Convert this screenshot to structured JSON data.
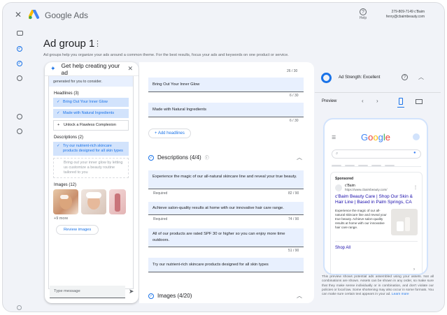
{
  "header": {
    "brand": "Google Ads",
    "help_label": "Help",
    "account_id": "279-809-7149 c'Baim",
    "account_email": "fenry@cbaimbeauty.com"
  },
  "page": {
    "title": "Ad group 1",
    "subtitle": "Ad groups help you organize your ads around a common theme. For the best results, focus your ads and keywords on one product or service."
  },
  "assistant": {
    "title": "Get help creating your ad",
    "intro": "generated for you to consider.",
    "headlines_label": "Headlines (3)",
    "headlines": [
      {
        "text": "Bring Out Your Inner Glow",
        "state": "selected"
      },
      {
        "text": "Made with Natural Ingredients",
        "state": "selected"
      },
      {
        "text": "Unlock a Flawless Complexion",
        "state": "unselected"
      }
    ],
    "descriptions_label": "Descriptions (2)",
    "descriptions": [
      {
        "text": "Try our nutrient-rich skincare products designed for all skin types",
        "state": "selected"
      },
      {
        "text": "Bring out your inner glow by letting us customize a beauty routine tailored to you",
        "state": "faded"
      }
    ],
    "images_label": "Images (12)",
    "images_more": "+9 more",
    "review_label": "Review images",
    "message_placeholder": "Type message"
  },
  "editor": {
    "counts": [
      "26 / 30",
      "6 / 30",
      "6 / 30"
    ],
    "headline_fields": [
      "Bring Out Your Inner Glow",
      "Made with Natural Ingredients"
    ],
    "add_headlines": "Add headlines",
    "descriptions_header": "Descriptions (4/4)",
    "descriptions": [
      {
        "text": "Experience the magic of our all-natural skincare line and reveal your true beauty.",
        "count": "82 / 90"
      },
      {
        "text": "Achieve salon-quality results at home with our innovative hair care range.",
        "count": "74 / 90"
      },
      {
        "text": "All of our products are rated SPF 30 or higher so you can enjoy more time outdoors.",
        "count": "51 / 90"
      },
      {
        "text": "Try our nutrient-rich skincare products designed for all skin types",
        "count": ""
      }
    ],
    "required_label": "Required",
    "images_header": "Images (4/20)"
  },
  "preview": {
    "strength": "Ad Strength: Excellent",
    "label": "Preview",
    "google": "Google",
    "sponsored": "Sponsored",
    "advertiser": "c'Baim",
    "advertiser_url": "https://www.cbaimbeauty.com/",
    "headline": "c'Baim Beauty Care | Shop Our Skin & Hair Line | Based in Palm Springs, CA",
    "description": "Experience the magic of our all-natural skincare line and reveal your true beauty. Achieve salon-quality results at home with our innovative hair care range.",
    "shop_all": "Shop All",
    "disclaimer": "This preview shows potential ads assembled using your assets. Not all combinations are shown. Assets can be shown in any order, so make sure that they make sense individually or in combination, and don't violate our policies or local law. Some shortening may also occur in some formats. You can make sure certain text appears in your ad.",
    "learn_more": "Learn more"
  },
  "colors": {
    "accent": "#1a73e8",
    "selected_bg": "#d2e3fc",
    "field_bg": "#e8f0fe"
  }
}
